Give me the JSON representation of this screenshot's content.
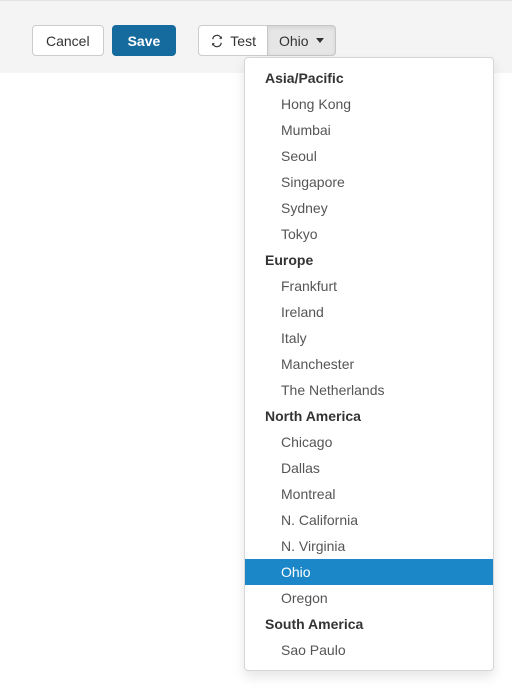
{
  "toolbar": {
    "cancel_label": "Cancel",
    "save_label": "Save",
    "test_label": "Test",
    "test_icon": "refresh-icon",
    "region_label": "Ohio",
    "caret_icon": "caret-down-icon"
  },
  "colors": {
    "toolbar_background": "#f4f4f4",
    "primary_button": "#156a9e",
    "menu_highlight": "#1b87c9",
    "menu_border": "#d6d6d6",
    "item_text": "#555555",
    "header_text": "#333333"
  },
  "dropdown": {
    "selected": "Ohio",
    "groups": [
      {
        "label": "Asia/Pacific",
        "items": [
          "Hong Kong",
          "Mumbai",
          "Seoul",
          "Singapore",
          "Sydney",
          "Tokyo"
        ]
      },
      {
        "label": "Europe",
        "items": [
          "Frankfurt",
          "Ireland",
          "Italy",
          "Manchester",
          "The Netherlands"
        ]
      },
      {
        "label": "North America",
        "items": [
          "Chicago",
          "Dallas",
          "Montreal",
          "N. California",
          "N. Virginia",
          "Ohio",
          "Oregon"
        ]
      },
      {
        "label": "South America",
        "items": [
          "Sao Paulo"
        ]
      }
    ]
  }
}
